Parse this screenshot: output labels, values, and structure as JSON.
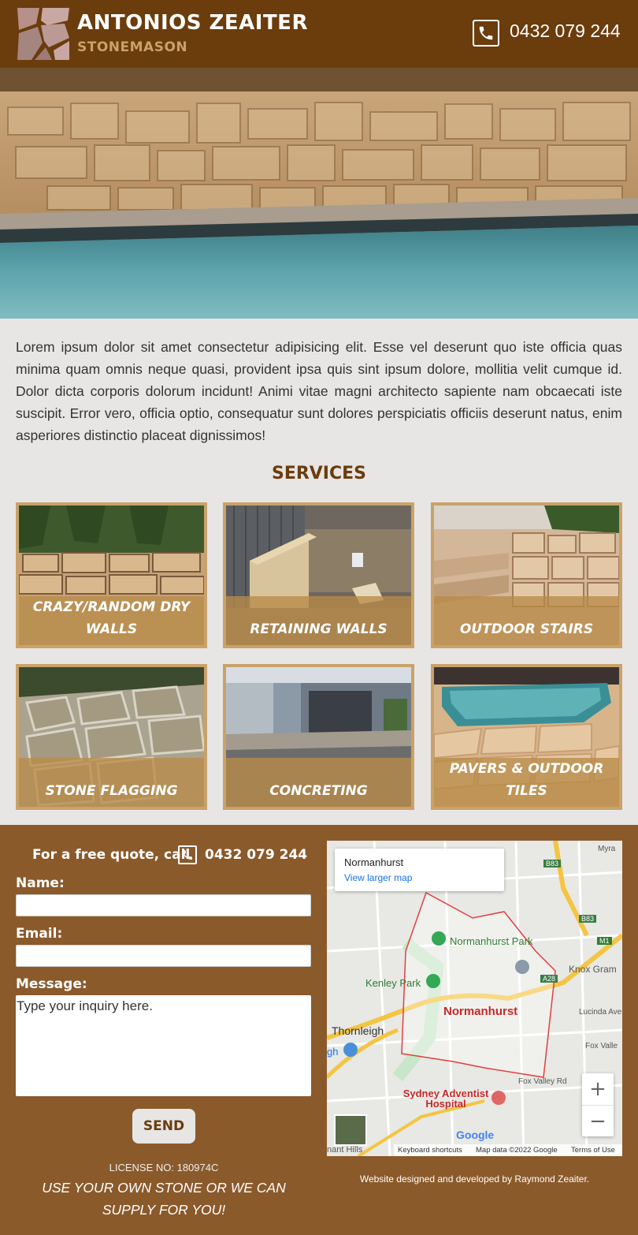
{
  "header": {
    "brand_name": "ANTONIOS ZEAITER",
    "brand_subtitle": "STONEMASON",
    "phone": "0432 079 244",
    "phone_icon": "phone-icon",
    "logo_icon": "stone-logo-icon"
  },
  "intro": {
    "text": "Lorem ipsum dolor sit amet consectetur adipisicing elit. Esse vel deserunt quo iste officia quas minima quam omnis neque quasi, provident ipsa quis sint ipsum dolore, mollitia velit cumque id. Dolor dicta corporis dolorum incidunt! Animi vitae magni architecto sapiente nam obcaecati iste suscipit. Error vero, officia optio, consequatur sunt dolores perspiciatis officiis deserunt natus, enim asperiores distinctio placeat dignissimos!"
  },
  "services": {
    "title": "SERVICES",
    "items": [
      {
        "label": "CRAZY/RANDOM DRY WALLS"
      },
      {
        "label": "RETAINING WALLS"
      },
      {
        "label": "OUTDOOR STAIRS"
      },
      {
        "label": "STONE FLAGGING"
      },
      {
        "label": "CONCRETING"
      },
      {
        "label": "PAVERS & OUTDOOR TILES"
      }
    ]
  },
  "contact": {
    "quote_text": "For a free quote, call",
    "phone": "0432 079 244",
    "name_label": "Name:",
    "email_label": "Email:",
    "message_label": "Message:",
    "name_value": "",
    "email_value": "",
    "message_placeholder": "Type your inquiry here.",
    "send_label": "SEND",
    "license": "LICENSE NO: 180974C",
    "tagline": "USE YOUR OWN STONE OR WE CAN SUPPLY FOR YOU!"
  },
  "map": {
    "place_title": "Normanhurst",
    "larger_map_link": "View larger map",
    "labels": {
      "normanhurst_park": "Normanhurst Park",
      "kenley_park": "Kenley Park",
      "normanhurst": "Normanhurst",
      "thornleigh": "Thornleigh",
      "hospital": "Sydney Adventist Hospital",
      "knox": "Knox Gram",
      "lucinda": "Lucinda Ave",
      "fox_valley": "Fox Valle",
      "fox_valley_rd": "Fox Valley Rd",
      "myra": "Myra",
      "b83_a": "B83",
      "b83_b": "B83",
      "m1": "M1",
      "a28": "A28",
      "gh": "gh",
      "nant_hills": "nant Hills",
      "google": "Google"
    },
    "zoom_in": "+",
    "zoom_out": "−",
    "keyboard_shortcuts": "Keyboard shortcuts",
    "map_data": "Map data ©2022 Google",
    "terms": "Terms of Use"
  },
  "credit": "Website designed and developed by Raymond Zeaiter.",
  "colors": {
    "header_bg": "#6b3c0c",
    "accent_gold": "#c9a26a",
    "footer_bg": "#8b5a2b",
    "page_bg": "#e8e5e5"
  }
}
